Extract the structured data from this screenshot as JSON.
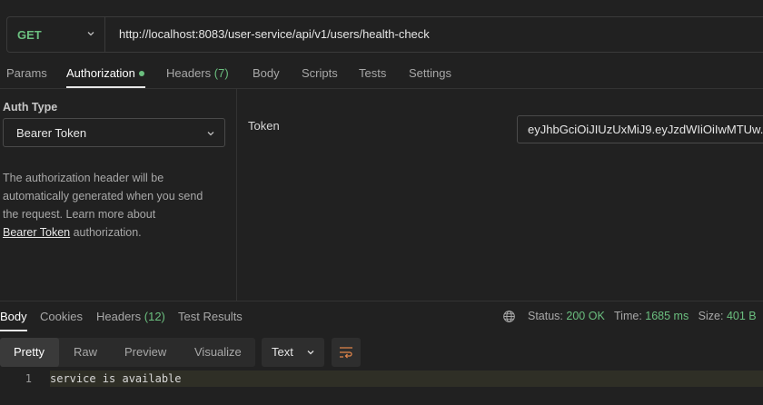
{
  "request": {
    "method": "GET",
    "url": "http://localhost:8083/user-service/api/v1/users/health-check"
  },
  "request_tabs": [
    {
      "label": "Params",
      "count": ""
    },
    {
      "label": "Authorization",
      "count": ""
    },
    {
      "label": "Headers",
      "count": "(7)"
    },
    {
      "label": "Body",
      "count": ""
    },
    {
      "label": "Scripts",
      "count": ""
    },
    {
      "label": "Tests",
      "count": ""
    },
    {
      "label": "Settings",
      "count": ""
    }
  ],
  "auth": {
    "type_label": "Auth Type",
    "type_value": "Bearer Token",
    "desc_line1": "The authorization header will be",
    "desc_line2": "automatically generated when you send",
    "desc_line3": "the request. Learn more about",
    "link_text": "Bearer Token",
    "desc_tail": " authorization.",
    "token_label": "Token",
    "token_value": "eyJhbGciOiJIUzUxMiJ9.eyJzdWIiOiIwMTUw..."
  },
  "response_tabs": [
    {
      "label": "Body",
      "count": ""
    },
    {
      "label": "Cookies",
      "count": ""
    },
    {
      "label": "Headers",
      "count": "(12)"
    },
    {
      "label": "Test Results",
      "count": ""
    }
  ],
  "response_status": {
    "status_label": "Status:",
    "status_value": "200 OK",
    "time_label": "Time:",
    "time_value": "1685 ms",
    "size_label": "Size:",
    "size_value": "401 B"
  },
  "body_views": [
    "Pretty",
    "Raw",
    "Preview",
    "Visualize"
  ],
  "body_format": "Text",
  "body_lines": [
    {
      "num": "1",
      "text": "service is available"
    }
  ],
  "colors": {
    "accent_green": "#6bbf7f",
    "background": "#212121"
  }
}
